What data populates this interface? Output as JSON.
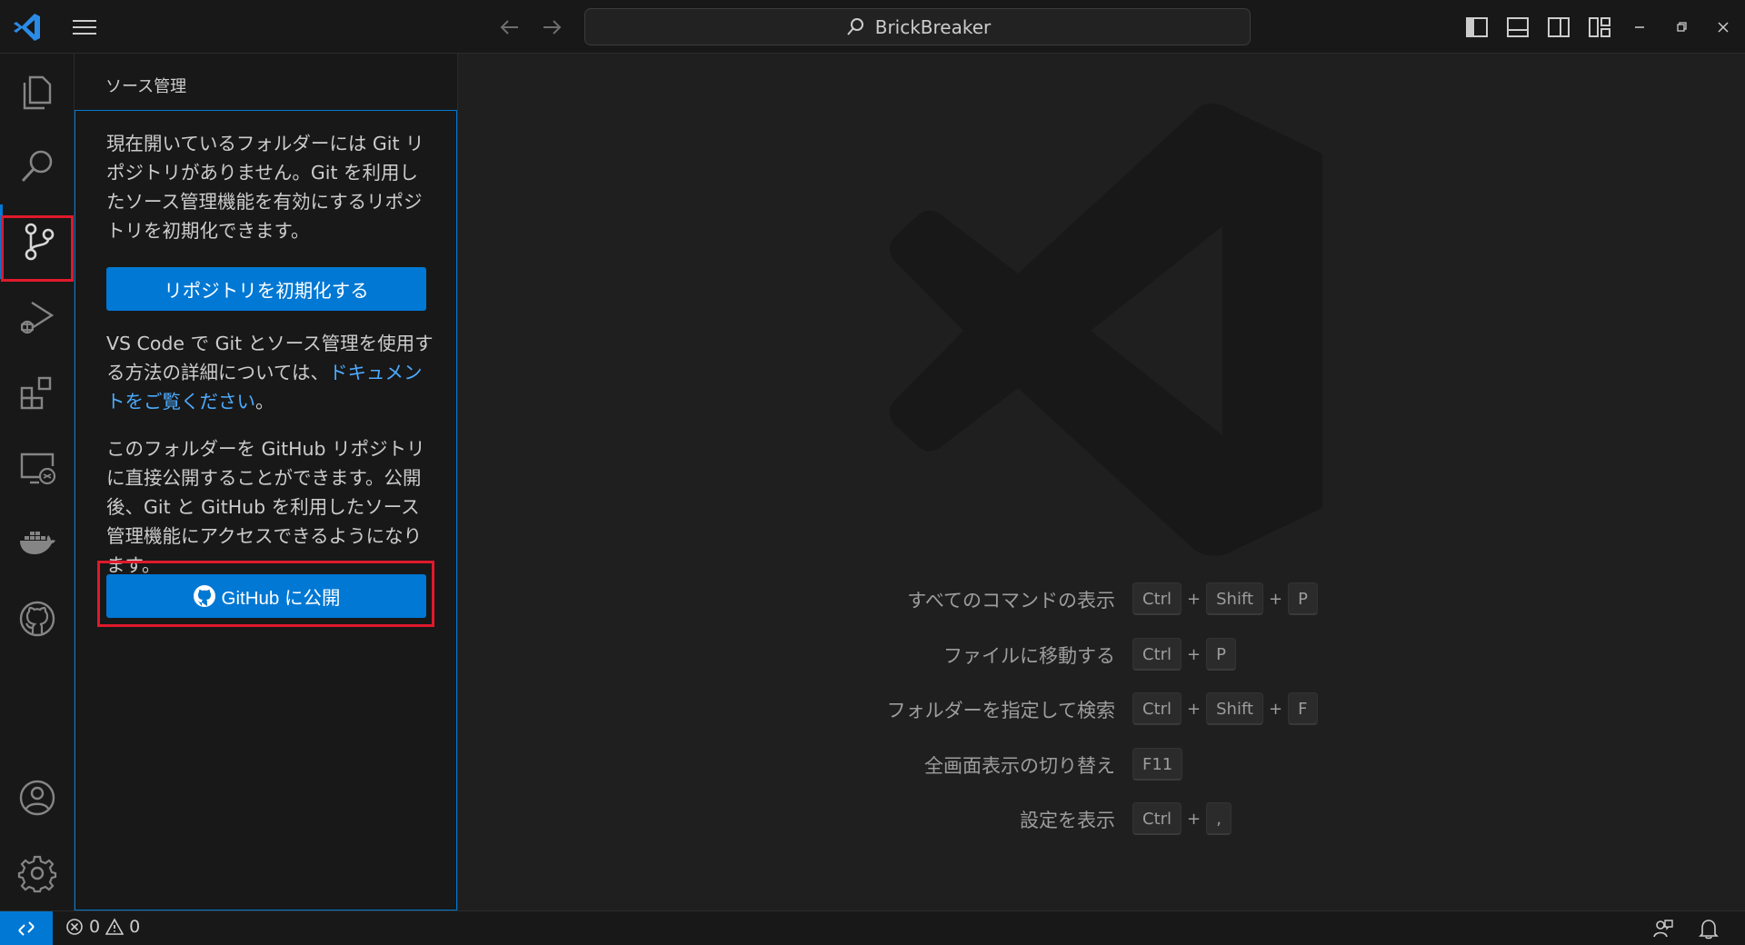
{
  "titlebar": {
    "search_text": "BrickBreaker"
  },
  "sidebar": {
    "title": "ソース管理",
    "intro_text": "現在開いているフォルダーには Git リポジトリがありません。Git を利用したソース管理機能を有効にするリポジトリを初期化できます。",
    "init_button_label": "リポジトリを初期化する",
    "docs_text_before": "VS Code で Git とソース管理を使用する方法の詳細については、",
    "docs_link_text": "ドキュメントをご覧ください",
    "docs_text_after": "。",
    "publish_text": "このフォルダーを GitHub リポジトリに直接公開することができます。公開後、Git と GitHub を利用したソース管理機能にアクセスできるようになります。",
    "publish_button_label": "GitHub に公開"
  },
  "shortcuts": [
    {
      "label": "すべてのコマンドの表示",
      "keys": [
        "Ctrl",
        "Shift",
        "P"
      ]
    },
    {
      "label": "ファイルに移動する",
      "keys": [
        "Ctrl",
        "P"
      ]
    },
    {
      "label": "フォルダーを指定して検索",
      "keys": [
        "Ctrl",
        "Shift",
        "F"
      ]
    },
    {
      "label": "全画面表示の切り替え",
      "keys": [
        "F11"
      ]
    },
    {
      "label": "設定を表示",
      "keys": [
        "Ctrl",
        ","
      ]
    }
  ],
  "statusbar": {
    "errors": "0",
    "warnings": "0"
  },
  "colors": {
    "accent": "#0078d4",
    "highlight": "#e0192b",
    "link": "#4daafc"
  }
}
